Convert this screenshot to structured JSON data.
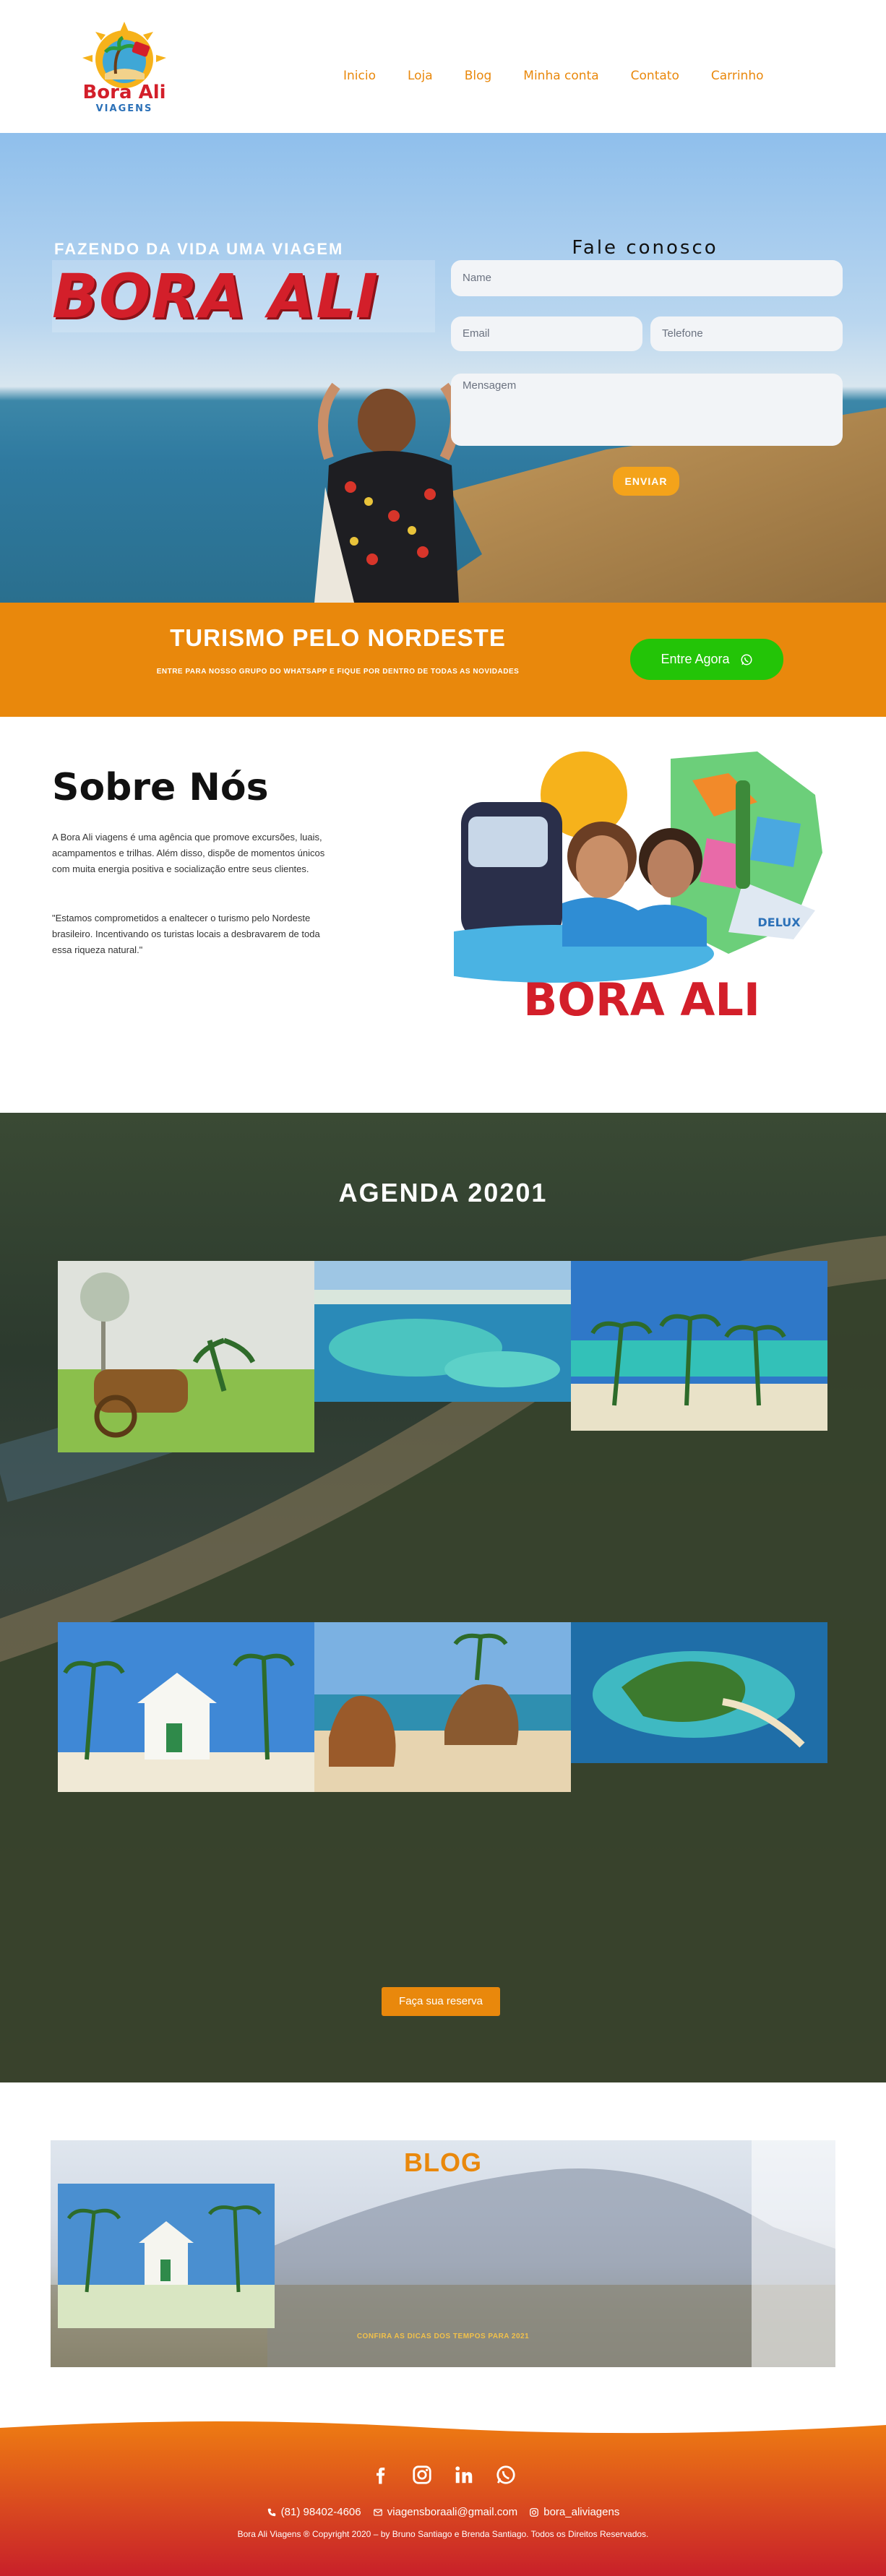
{
  "header": {
    "logo_line1": "Bora Ali",
    "logo_line2": "VIAGENS",
    "nav": [
      "Inicio",
      "Loja",
      "Blog",
      "Minha conta",
      "Contato",
      "Carrinho"
    ]
  },
  "hero": {
    "tagline": "FAZENDO DA VIDA UMA VIAGEM",
    "title": "BORA ALI",
    "contact_title": "Fale conosco",
    "name_placeholder": "Name",
    "email_placeholder": "Email",
    "phone_placeholder": "Telefone",
    "message_placeholder": "Mensagem",
    "send_label": "ENVIAR"
  },
  "band": {
    "title": "TURISMO PELO NORDESTE",
    "subtitle": "ENTRE PARA NOSSO GRUPO DO WHATSAPP E FIQUE POR DENTRO DE TODAS AS NOVIDADES",
    "button_label": "Entre Agora"
  },
  "about": {
    "title": "Sobre Nós",
    "paragraph1": "A Bora Ali viagens é uma agência que promove excursões, luais, acampamentos e trilhas. Além disso, dispõe de momentos únicos com muita energia positiva e socialização entre seus clientes.",
    "paragraph2": "\"Estamos comprometidos a enaltecer o turismo pelo Nordeste brasileiro. Incentivando os turistas locais a desbravarem de toda essa riqueza natural.\"",
    "art_label": "BORA ALI",
    "boat_label": "DELUX"
  },
  "agenda": {
    "title": "AGENDA 20201",
    "button_label": "Faça sua reserva"
  },
  "blog": {
    "title": "BLOG",
    "caption": "CONFIRA AS DICAS DOS TEMPOS PARA 2021"
  },
  "footer": {
    "phone": "(81) 98402-4606",
    "email": "viagensboraali@gmail.com",
    "instagram": "bora_aliviagens",
    "copyright": "Bora Ali Viagens ® Copyright 2020 – by Bruno Santiago e Brenda Santiago. Todos os Direitos Reservados."
  },
  "colors": {
    "accent_orange": "#e9880c",
    "brand_red": "#d31f2a",
    "whatsapp_green": "#23c407",
    "footer_red": "#c8202a"
  }
}
